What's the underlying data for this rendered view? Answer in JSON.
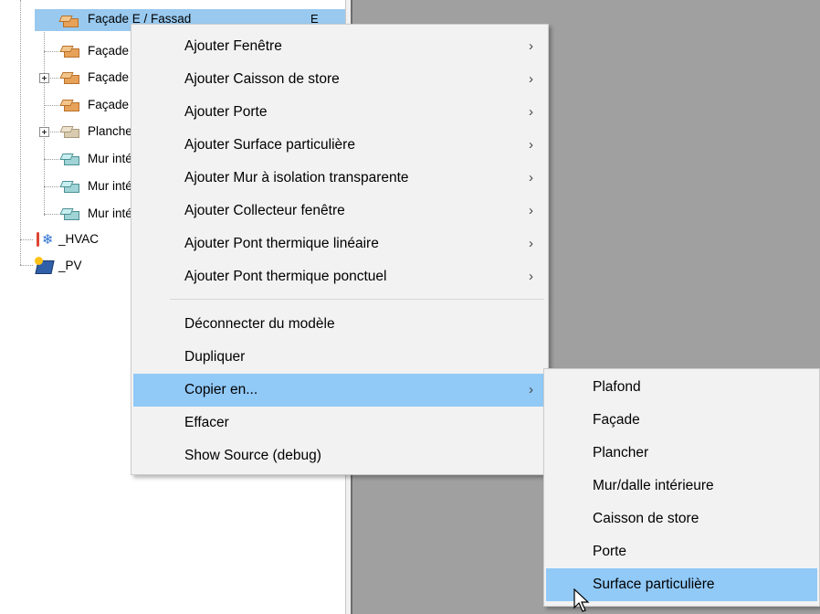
{
  "tree": {
    "selected": {
      "label": "Façade E / Fassad",
      "extra": "E"
    },
    "items": [
      {
        "label": "Façade",
        "icon": "facade-box-icon"
      },
      {
        "label": "Façade",
        "icon": "facade-box-icon"
      },
      {
        "label": "Façade",
        "icon": "facade-box-icon"
      },
      {
        "label": "Plancher",
        "icon": "floor-box-icon"
      },
      {
        "label": "Mur intérieur",
        "icon": "wall-box-icon"
      },
      {
        "label": "Mur intérieur",
        "icon": "wall-box-icon"
      },
      {
        "label": "Mur intérieur",
        "icon": "wall-box-icon"
      }
    ],
    "hvac": "_HVAC",
    "pv": "_PV"
  },
  "context_menu": {
    "items": [
      {
        "label": "Ajouter Fenêtre",
        "arrow": "›"
      },
      {
        "label": "Ajouter Caisson de store",
        "arrow": "›"
      },
      {
        "label": "Ajouter Porte",
        "arrow": "›"
      },
      {
        "label": "Ajouter Surface particulière",
        "arrow": "›"
      },
      {
        "label": "Ajouter Mur à isolation transparente",
        "arrow": "›"
      },
      {
        "label": "Ajouter Collecteur fenêtre",
        "arrow": "›"
      },
      {
        "label": "Ajouter Pont thermique linéaire",
        "arrow": "›"
      },
      {
        "label": "Ajouter Pont thermique ponctuel",
        "arrow": "›"
      }
    ],
    "items2": [
      {
        "label": "Déconnecter du modèle"
      },
      {
        "label": "Dupliquer"
      },
      {
        "label": "Copier en...",
        "arrow": "›",
        "highlighted": true
      },
      {
        "label": "Effacer"
      },
      {
        "label": "Show Source (debug)"
      }
    ]
  },
  "submenu": {
    "items": [
      {
        "label": "Plafond"
      },
      {
        "label": "Façade"
      },
      {
        "label": "Plancher"
      },
      {
        "label": "Mur/dalle intérieure"
      },
      {
        "label": "Caisson de store"
      },
      {
        "label": "Porte"
      },
      {
        "label": "Surface particulière",
        "highlighted": true
      }
    ]
  },
  "colors": {
    "highlight": "#91c9f7",
    "selection": "#99c9ef",
    "workspace": "#a0a0a0"
  }
}
